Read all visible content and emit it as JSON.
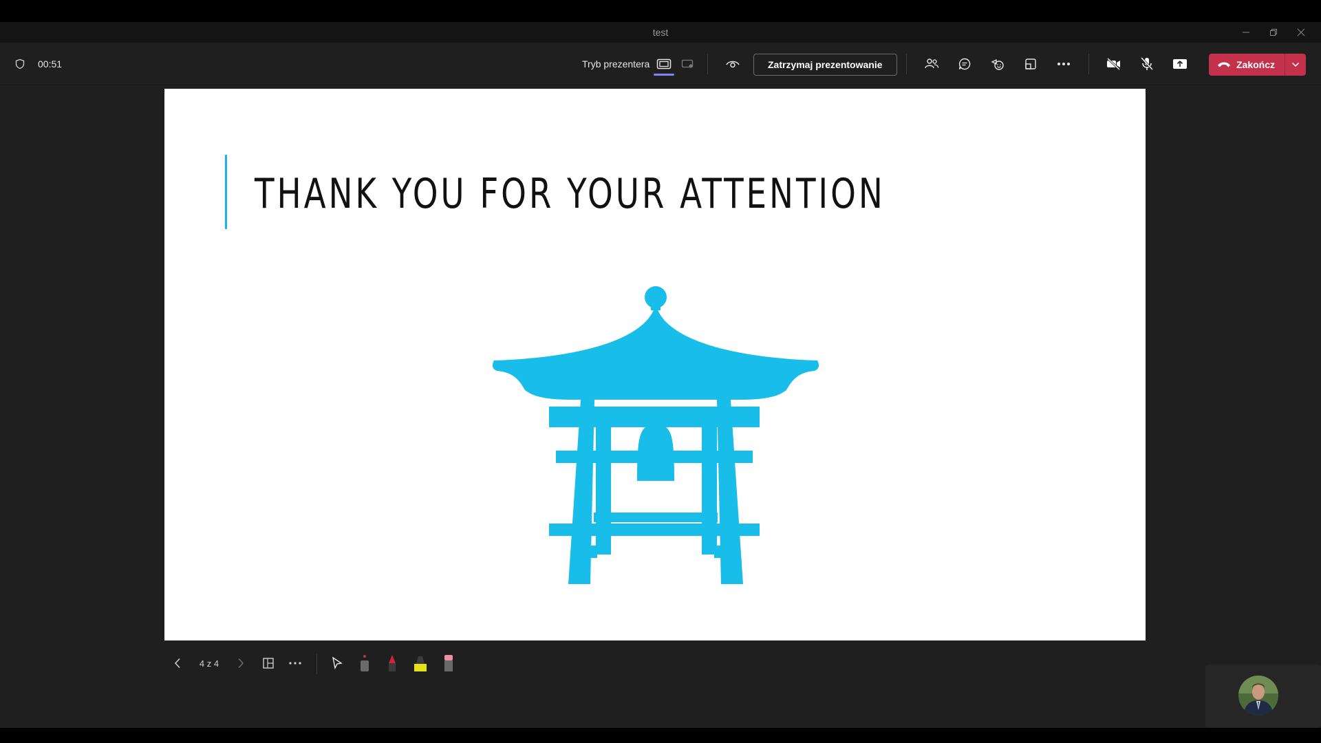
{
  "window": {
    "title": "test"
  },
  "toolbar": {
    "timer": "00:51",
    "presenter_mode_label": "Tryb prezentera",
    "stop_presenting_label": "Zatrzymaj prezentowanie",
    "end_label": "Zakończ"
  },
  "slide": {
    "title": "THANK YOU FOR YOUR ATTENTION",
    "accent_color": "#1ab3e6",
    "image_icon": "bell-tower-icon"
  },
  "slide_controls": {
    "pager": "4 z 4"
  },
  "colors": {
    "end_button": "#c4314b",
    "mode_selected": "#7f85f5"
  }
}
